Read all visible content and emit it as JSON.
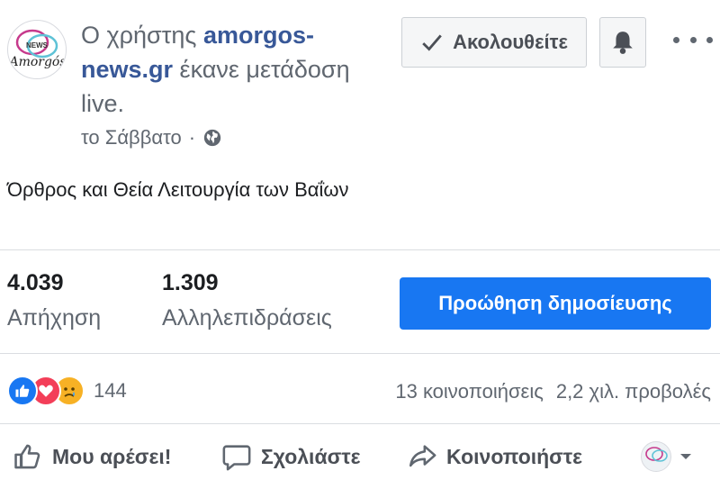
{
  "header": {
    "prefix": "Ο χρήστης",
    "page_name": "amorgos-news.gr",
    "suffix": "έκανε μετάδοση live.",
    "timestamp": "το Σάββατο",
    "separator": "·",
    "globe_icon": "globe-icon",
    "avatar_alt": "amorgos-news logo",
    "avatar_small_text": "NEWS",
    "avatar_text": "Αmorgós",
    "follow_label": "Ακολουθείτε",
    "follow_icon": "checkmark-icon",
    "bell_icon": "bell-icon",
    "more_icon": "more-horizontal-icon"
  },
  "post": {
    "text": "Όρθρος και Θεία Λειτουργία των Βαΐων"
  },
  "stats": {
    "reach_value": "4.039",
    "reach_label": "Απήχηση",
    "engagement_value": "1.309",
    "engagement_label": "Αλληλεπιδράσεις",
    "boost_label": "Προώθηση δημοσίευσης"
  },
  "reactions": {
    "icons": [
      "like-reaction-icon",
      "love-reaction-icon",
      "sad-reaction-icon"
    ],
    "count": "144",
    "shares": "13 κοινοποιήσεις",
    "views": "2,2 χιλ. προβολές"
  },
  "actions": {
    "like": "Μου αρέσει!",
    "comment": "Σχολιάστε",
    "share": "Κοινοποιήστε"
  },
  "colors": {
    "link": "#385898",
    "primary": "#1877f2",
    "text_secondary": "#606770"
  }
}
